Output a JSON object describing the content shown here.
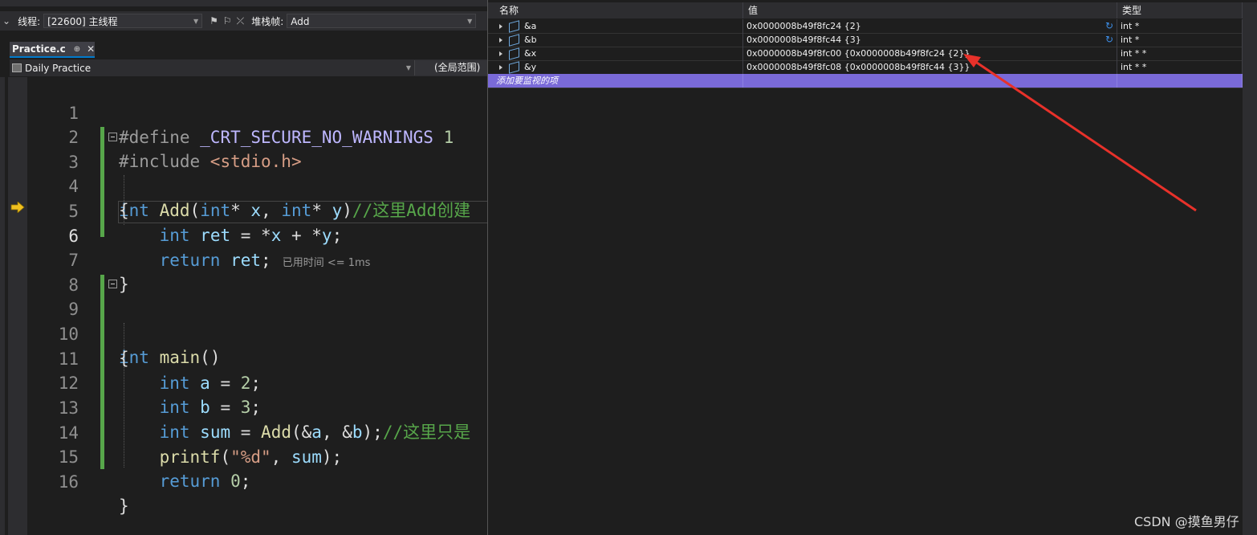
{
  "thread_bar": {
    "thread_label": "线程:",
    "thread_value": "[22600] 主线程",
    "stack_label": "堆栈帧:",
    "stack_value": "Add"
  },
  "tab": {
    "title": "Practice.c",
    "pin": "⊕",
    "close": "✕"
  },
  "navbar": {
    "project": "Daily Practice",
    "scope": "(全局范围)"
  },
  "editor": {
    "line_numbers": [
      "1",
      "2",
      "3",
      "4",
      "5",
      "6",
      "7",
      "8",
      "9",
      "10",
      "11",
      "12",
      "13",
      "14",
      "15",
      "16"
    ],
    "current_line": "6",
    "inline_hint": "已用时间 <= 1ms"
  },
  "watch": {
    "headers": {
      "name": "名称",
      "value": "值",
      "type": "类型"
    },
    "rows": [
      {
        "name": "&a",
        "value": "0x0000008b49f8fc24 {2}",
        "type": "int *"
      },
      {
        "name": "&b",
        "value": "0x0000008b49f8fc44 {3}",
        "type": "int *"
      },
      {
        "name": "&x",
        "value": "0x0000008b49f8fc00 {0x0000008b49f8fc24 {2}}",
        "type": "int * *"
      },
      {
        "name": "&y",
        "value": "0x0000008b49f8fc08 {0x0000008b49f8fc44 {3}}",
        "type": "int * *"
      }
    ],
    "add_item_hint": "添加要监视的项"
  },
  "annotation_color": "#e8312a",
  "watermark": "CSDN @摸鱼男仔"
}
